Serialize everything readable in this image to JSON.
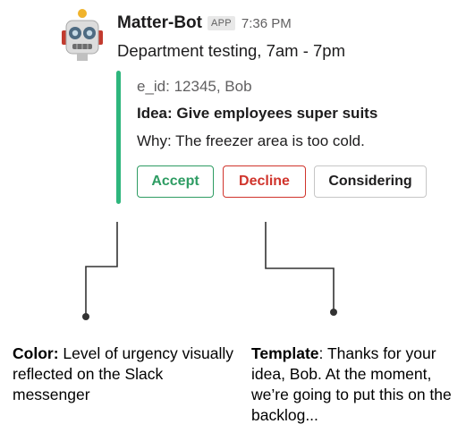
{
  "message": {
    "sender": "Matter-Bot",
    "badge": "APP",
    "timestamp": "7:36 PM",
    "text": "Department testing, 7am - 7pm",
    "avatar_icon": "robot-icon"
  },
  "attachment": {
    "color": "#2eb67d",
    "id_line": "e_id: 12345, Bob",
    "idea_line": "Idea: Give employees super suits",
    "why_line": "Why: The freezer area is too cold."
  },
  "actions": {
    "accept": "Accept",
    "decline": "Decline",
    "considering": "Considering"
  },
  "annotations": {
    "color_note": {
      "label": "Color:",
      "text": " Level of urgency visually reflected on the Slack messenger"
    },
    "template_note": {
      "label": "Template",
      "text": ": Thanks for your idea, Bob. At the moment, we’re going to put this on the backlog..."
    }
  }
}
